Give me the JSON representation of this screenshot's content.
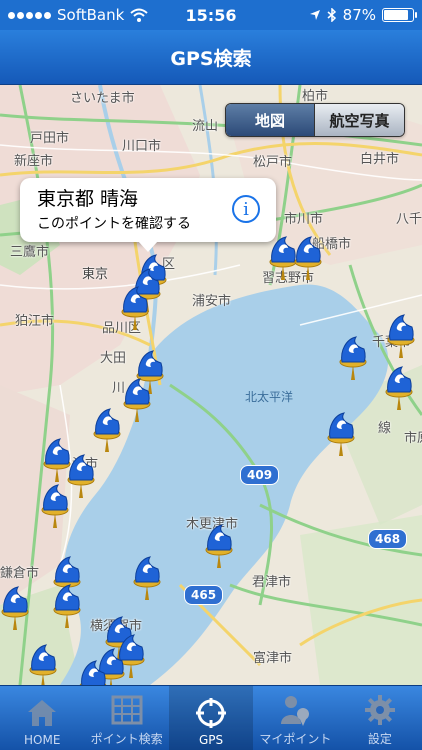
{
  "status_bar": {
    "carrier": "SoftBank",
    "time": "15:56",
    "battery": "87%",
    "battery_level": 0.87
  },
  "nav": {
    "title": "GPS検索"
  },
  "map_type": {
    "map_label": "地図",
    "satellite_label": "航空写真",
    "selected": "地図"
  },
  "callout": {
    "title": "東京都 晴海",
    "subtitle": "このポイントを確認する",
    "info_icon": "i"
  },
  "map_labels": {
    "saitama": "さいたま市",
    "kashiwa": "柏市",
    "nagareyama": "流山",
    "toda": "戸田市",
    "kawaguchi": "川口市",
    "niiza": "新座市",
    "matsudo": "松戸市",
    "shiroi": "白井市",
    "ichikawa": "市川市",
    "yachiyo": "八千",
    "mitaka": "三鷹市",
    "funabashi": "船橋市",
    "tokyo": "東京",
    "kuku": "区",
    "narashino": "習志野市",
    "komae": "狛江市",
    "urayasu": "浦安市",
    "shinagawa": "品川区",
    "chiba": "千葉市",
    "ota": "大田",
    "kawa": "川",
    "kitataiheiyo": "北太平洋",
    "ichihara": "市原",
    "kisarazu": "木更津市",
    "kamakura": "鎌倉市",
    "kimitsu": "君津市",
    "yokosuka": "横須賀市",
    "futtsu": "富津市",
    "hama": "浜市",
    "sen": "線"
  },
  "routes": {
    "r409": "409",
    "r468": "468",
    "r465": "465"
  },
  "tabs": [
    {
      "label": "HOME",
      "icon": "house-icon"
    },
    {
      "label": "ポイント検索",
      "icon": "map-grid-icon"
    },
    {
      "label": "GPS",
      "icon": "crosshair-icon",
      "selected": true
    },
    {
      "label": "マイポイント",
      "icon": "person-pin-icon"
    },
    {
      "label": "設定",
      "icon": "gear-icon"
    }
  ]
}
